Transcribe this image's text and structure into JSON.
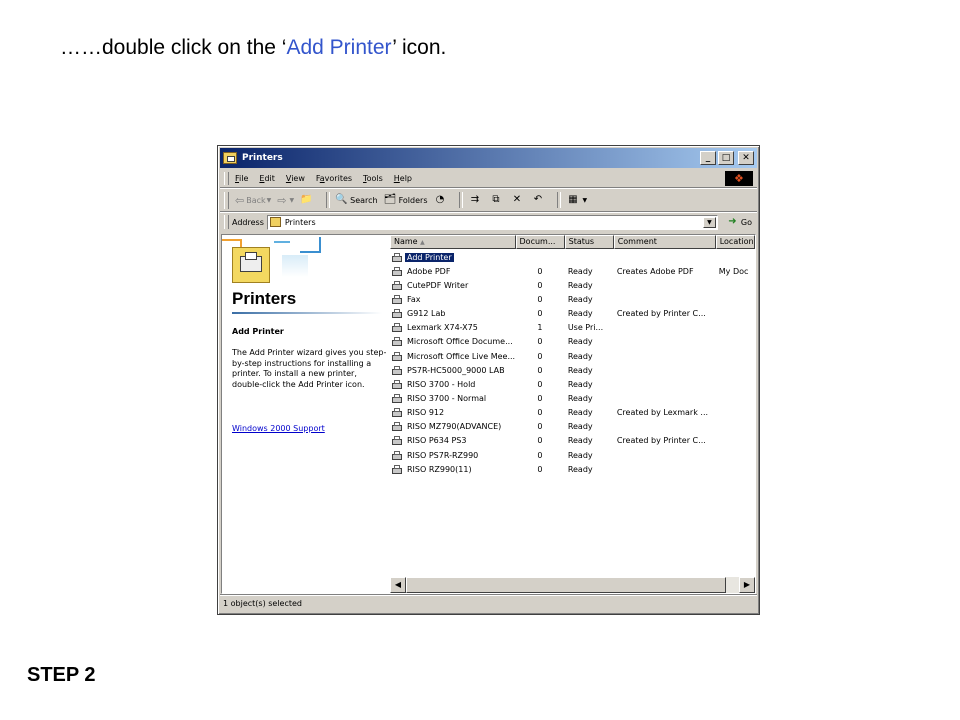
{
  "instruction": {
    "prefix": "……double click on the ‘",
    "highlight": "Add Printer",
    "suffix": "’ icon."
  },
  "step_label": "STEP 2",
  "window": {
    "title": "Printers",
    "menu": [
      "File",
      "Edit",
      "View",
      "Favorites",
      "Tools",
      "Help"
    ],
    "menu_accel": [
      "F",
      "E",
      "V",
      "a",
      "T",
      "H"
    ],
    "toolbar": {
      "back": "Back",
      "search": "Search",
      "folders": "Folders"
    },
    "address_label": "Address",
    "address_value": "Printers",
    "go_label": "Go",
    "panel": {
      "title": "Printers",
      "subtitle": "Add Printer",
      "description": "The Add Printer wizard gives you step-\nby-step instructions for installing a\nprinter. To install a new printer,\ndouble-click the Add Printer icon.",
      "link": "Windows 2000 Support"
    },
    "columns": [
      "Name",
      "Docum...",
      "Status",
      "Comment",
      "Location"
    ],
    "rows": [
      {
        "name": "Add Printer",
        "docs": "",
        "status": "",
        "comment": "",
        "location": ""
      },
      {
        "name": "Adobe PDF",
        "docs": "0",
        "status": "Ready",
        "comment": "Creates Adobe PDF",
        "location": "My Doc"
      },
      {
        "name": "CutePDF Writer",
        "docs": "0",
        "status": "Ready",
        "comment": "",
        "location": ""
      },
      {
        "name": "Fax",
        "docs": "0",
        "status": "Ready",
        "comment": "",
        "location": ""
      },
      {
        "name": "G912 Lab",
        "docs": "0",
        "status": "Ready",
        "comment": "Created by Printer C...",
        "location": ""
      },
      {
        "name": "Lexmark X74-X75",
        "docs": "1",
        "status": "Use Pri...",
        "comment": "",
        "location": ""
      },
      {
        "name": "Microsoft Office Docume...",
        "docs": "0",
        "status": "Ready",
        "comment": "",
        "location": ""
      },
      {
        "name": "Microsoft Office Live Mee...",
        "docs": "0",
        "status": "Ready",
        "comment": "",
        "location": ""
      },
      {
        "name": "PS7R-HC5000_9000 LAB",
        "docs": "0",
        "status": "Ready",
        "comment": "",
        "location": ""
      },
      {
        "name": "RISO 3700 - Hold",
        "docs": "0",
        "status": "Ready",
        "comment": "",
        "location": ""
      },
      {
        "name": "RISO 3700 - Normal",
        "docs": "0",
        "status": "Ready",
        "comment": "",
        "location": ""
      },
      {
        "name": "RISO 912",
        "docs": "0",
        "status": "Ready",
        "comment": "Created by Lexmark ...",
        "location": ""
      },
      {
        "name": "RISO MZ790(ADVANCE)",
        "docs": "0",
        "status": "Ready",
        "comment": "",
        "location": ""
      },
      {
        "name": "RISO P634 PS3",
        "docs": "0",
        "status": "Ready",
        "comment": "Created by Printer C...",
        "location": ""
      },
      {
        "name": "RISO PS7R-RZ990",
        "docs": "0",
        "status": "Ready",
        "comment": "",
        "location": ""
      },
      {
        "name": "RISO RZ990(11)",
        "docs": "0",
        "status": "Ready",
        "comment": "",
        "location": ""
      }
    ],
    "status_text": "1 object(s) selected"
  }
}
